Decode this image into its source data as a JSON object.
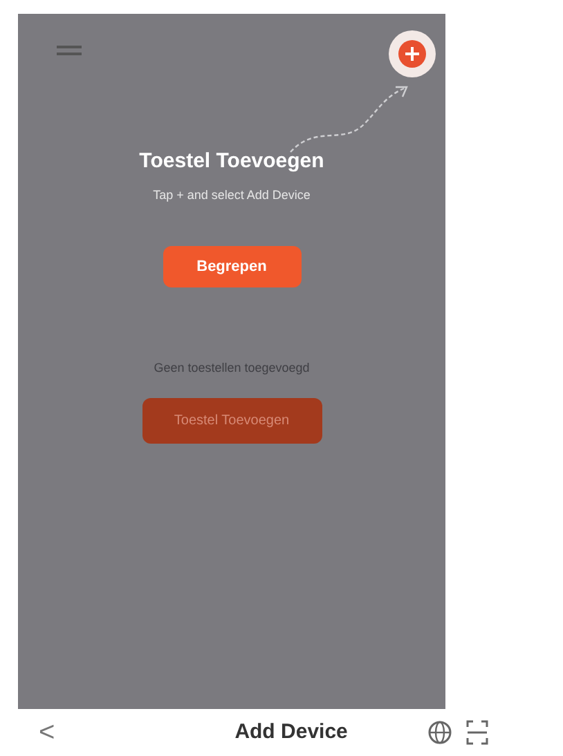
{
  "overlay": {
    "title": "Toestel Toevoegen",
    "hint": "Tap + and select Add Device",
    "dismiss_button": "Begrepen"
  },
  "empty_state": {
    "message": "Geen toestellen toegevoegd",
    "add_button": "Toestel Toevoegen"
  },
  "nav_bar": {
    "back": "<",
    "title": "Add Device"
  }
}
